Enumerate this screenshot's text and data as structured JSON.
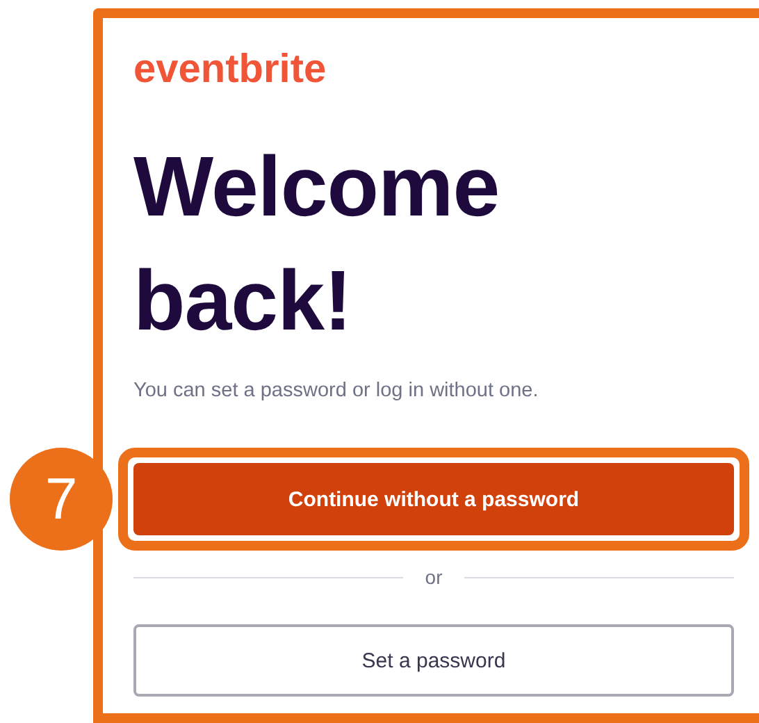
{
  "logo": "eventbrite",
  "heading_lines": [
    "Welcome",
    "back!"
  ],
  "subtitle": "You can set a password or log in without one.",
  "step_badge": "7",
  "primary_button": {
    "label": "Continue without a password",
    "highlighted": true
  },
  "divider_text": "or",
  "secondary_button": {
    "label": "Set a password"
  }
}
